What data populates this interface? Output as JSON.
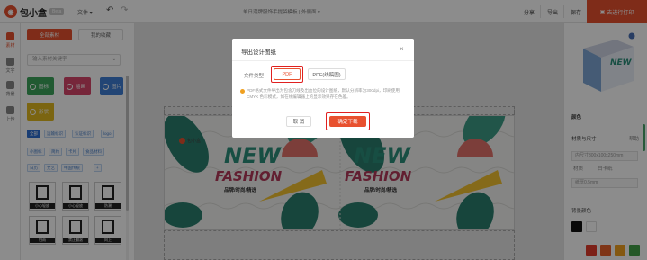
{
  "app": {
    "logo_text": "包小盒",
    "logo_badge": "Beta",
    "menu_file": "文件 ▾",
    "undo_glyph": "↶",
    "redo_glyph": "↷",
    "doc_title": "单日潮牌服饰手提袋模板 | 外侧面 ▾",
    "share_label": "分享",
    "export_label": "导出",
    "save_label": "保存",
    "order_label": "去进行打印"
  },
  "rail": [
    {
      "label": "素材",
      "active": true
    },
    {
      "label": "文字",
      "active": false
    },
    {
      "label": "背景",
      "active": false
    },
    {
      "label": "上传",
      "active": false
    }
  ],
  "left_panel": {
    "tab_active": "全部素材",
    "tab_other": "我的收藏",
    "search_placeholder": "输入素材关键字",
    "materials": [
      {
        "label": "图标",
        "color": "#3ca55c"
      },
      {
        "label": "插画",
        "color": "#d8466a"
      },
      {
        "label": "图片",
        "color": "#3f7fd6"
      },
      {
        "label": "形状",
        "color": "#e0b820"
      }
    ],
    "tags_row1": [
      "全部",
      "运输标识",
      "认证标识",
      "logo"
    ],
    "tags_row2": [
      "小图标",
      "简约",
      "卡片",
      "食品材料"
    ],
    "tags_row3": [
      "日历",
      "文艺",
      "中国传统",
      "+"
    ],
    "symbols": [
      "小心轻放",
      "小心轻放",
      "防潮",
      "怕雨",
      "禁止翻滚",
      "向上"
    ]
  },
  "canvas": {
    "new_text": "NEW",
    "fashion_text": "FASHION",
    "sub_text": "品牌/时尚/精选",
    "brand_text": "包小盒"
  },
  "right_panel": {
    "section_title": "颜色",
    "size_label": "材质与尺寸",
    "size_link": "帮助",
    "size_value": "内尺寸300x100x250mm",
    "material_label": "材质",
    "material_value": "白卡纸",
    "thickness_label": "纸厚0.5mm",
    "bg_label": "背景颜色",
    "swatches": [
      "#111111",
      "#ffffff",
      "#e23b2b",
      "#e8622a",
      "#f0a020",
      "#43a047"
    ]
  },
  "modal": {
    "title": "导出设计图纸",
    "close_glyph": "×",
    "file_type_label": "文件类型",
    "option_pdf": "PDF",
    "option_pdf_line": "PDF(线稿图)",
    "note": "PDF格式文件导出为包含刀线及出血位的设计图纸，默认分辨率为300dpi，印刷使用 CMYK 色彩模式，如在线编辑器上的显示效果存在色差。",
    "cancel_label": "取 消",
    "download_label": "确定下载"
  }
}
